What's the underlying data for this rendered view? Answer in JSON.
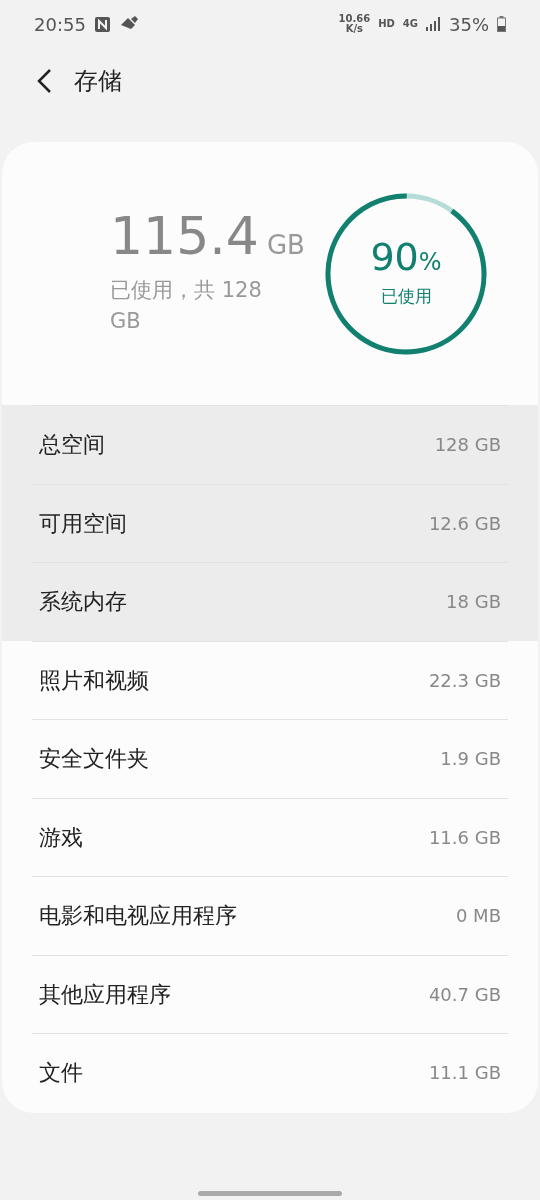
{
  "status_bar": {
    "time": "20:55",
    "net_speed": "10.66",
    "net_speed_unit": "K/s",
    "hd": "HD",
    "network": "4G",
    "battery": "35%"
  },
  "header": {
    "title": "存储"
  },
  "summary": {
    "used": "115.4",
    "used_unit": "GB",
    "caption": "已使用，共 128 GB",
    "ring": {
      "level": 0.9,
      "percent": "90",
      "percent_sign": "%",
      "label": "已使用"
    }
  },
  "rows": [
    {
      "label": "总空间",
      "value": "128 GB",
      "highlighted": true
    },
    {
      "label": "可用空间",
      "value": "12.6 GB",
      "highlighted": true
    },
    {
      "label": "系统内存",
      "value": "18 GB",
      "highlighted": true
    },
    {
      "label": "照片和视频",
      "value": "22.3 GB",
      "highlighted": false
    },
    {
      "label": "安全文件夹",
      "value": "1.9 GB",
      "highlighted": false
    },
    {
      "label": "游戏",
      "value": "11.6 GB",
      "highlighted": false
    },
    {
      "label": "电影和电视应用程序",
      "value": "0 MB",
      "highlighted": false
    },
    {
      "label": "其他应用程序",
      "value": "40.7 GB",
      "highlighted": false
    },
    {
      "label": "文件",
      "value": "11.1 GB",
      "highlighted": false
    }
  ]
}
